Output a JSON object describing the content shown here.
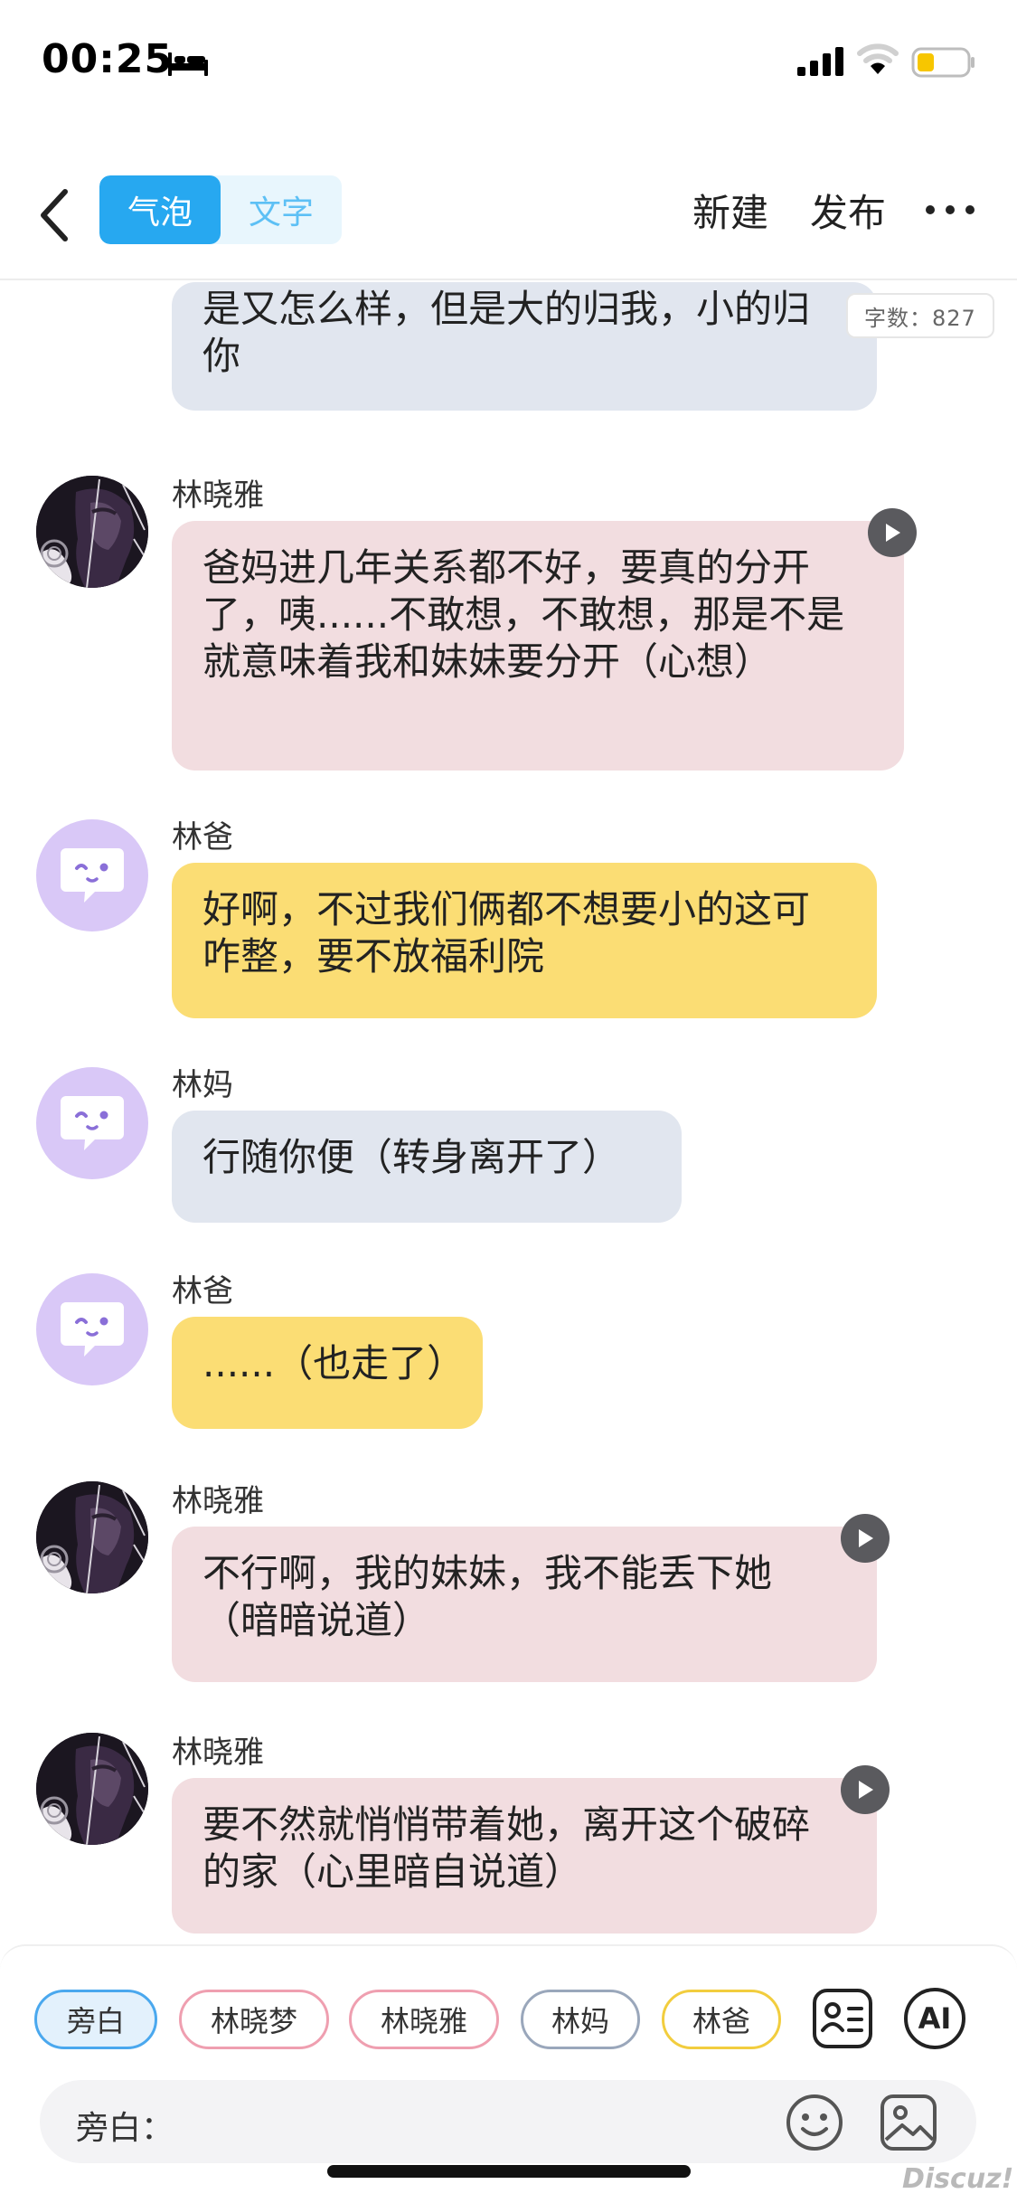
{
  "status_bar": {
    "time": "00:25"
  },
  "nav": {
    "tabs": [
      {
        "label": "气泡",
        "active": true
      },
      {
        "label": "文字",
        "active": false
      }
    ],
    "new_label": "新建",
    "publish_label": "发布"
  },
  "word_count": "字数：827",
  "messages": [
    {
      "sender": "",
      "text": "是又怎么样，但是大的归我，小的归你",
      "bubble": "gray",
      "avatar": "robot-avatar-icon"
    },
    {
      "sender": "林晓雅",
      "text": "爸妈进几年关系都不好，要真的分开了，咦......不敢想，不敢想，那是不是就意味着我和妹妹要分开（心想）",
      "bubble": "pink",
      "avatar": "character-portrait",
      "has_audio": true
    },
    {
      "sender": "林爸",
      "text": "好啊，不过我们俩都不想要小的这可咋整，要不放福利院",
      "bubble": "yellow",
      "avatar": "robot-avatar-icon"
    },
    {
      "sender": "林妈",
      "text": "行随你便（转身离开了）",
      "bubble": "gray",
      "avatar": "robot-avatar-icon"
    },
    {
      "sender": "林爸",
      "text": "......（也走了）",
      "bubble": "yellow",
      "avatar": "robot-avatar-icon"
    },
    {
      "sender": "林晓雅",
      "text": "不行啊，我的妹妹，我不能丢下她（暗暗说道）",
      "bubble": "pink",
      "avatar": "character-portrait",
      "has_audio": true
    },
    {
      "sender": "林晓雅",
      "text": "要不然就悄悄带着她，离开这个破碎的家（心里暗自说道）",
      "bubble": "pink",
      "avatar": "character-portrait",
      "has_audio": true
    }
  ],
  "roles": [
    {
      "label": "旁白",
      "selected": true
    },
    {
      "label": "林晓梦",
      "selected": false
    },
    {
      "label": "林晓雅",
      "selected": false
    },
    {
      "label": "林妈",
      "selected": false
    },
    {
      "label": "林爸",
      "selected": false
    }
  ],
  "ai_label": "AI",
  "input": {
    "label": "旁白：",
    "value": ""
  },
  "watermark": "Discuz!",
  "colors": {
    "accent": "#27a8f0",
    "bubble_gray": "#e1e6ef",
    "bubble_pink": "#f2dde0",
    "bubble_yellow": "#fbdd74",
    "battery_level": "#f7c600"
  }
}
